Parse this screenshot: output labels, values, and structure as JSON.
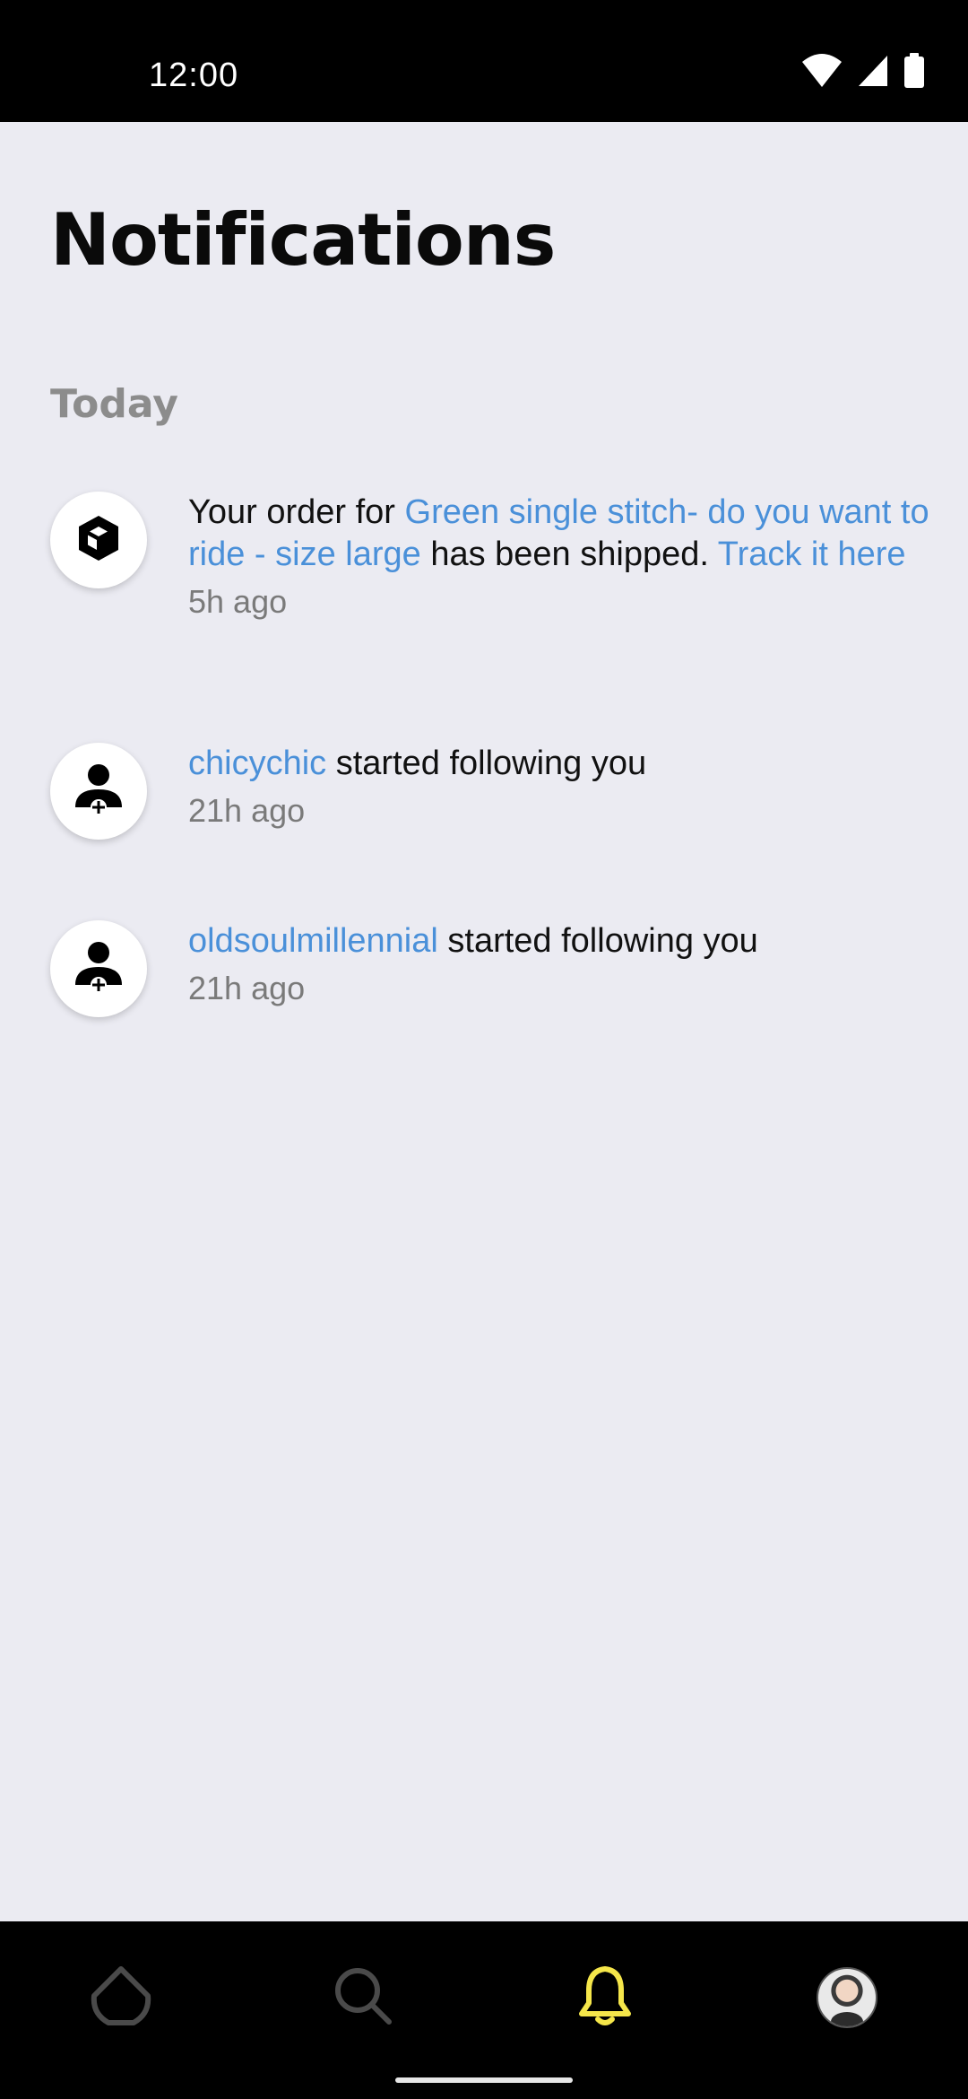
{
  "status_bar": {
    "time": "12:00",
    "icons": [
      "wifi-icon",
      "cellular-signal-icon",
      "battery-icon"
    ]
  },
  "page": {
    "title": "Notifications"
  },
  "sections": [
    {
      "heading": "Today",
      "notifications": [
        {
          "icon": "package-box-icon",
          "text_before": "Your order for ",
          "link_item": "Green single stitch- do you want to ride - size large",
          "text_after": " has been shipped. ",
          "link_track": "Track it here",
          "time": "5h ago"
        },
        {
          "icon": "person-add-icon",
          "link_user": "chicychic",
          "text_after": " started following you",
          "time": "21h ago"
        },
        {
          "icon": "person-add-icon",
          "link_user": "oldsoulmillennial",
          "text_after": " started following you",
          "time": "21h ago"
        }
      ]
    }
  ],
  "bottom_nav": {
    "items": [
      {
        "icon": "home-icon",
        "active": false
      },
      {
        "icon": "search-icon",
        "active": false
      },
      {
        "icon": "bell-icon",
        "active": true
      },
      {
        "icon": "profile-avatar",
        "active": false
      }
    ],
    "colors": {
      "active": "#f5e64a",
      "inactive": "#4a4a4a"
    }
  },
  "colors": {
    "background": "#ebebf2",
    "link": "#4a90d9",
    "muted": "#7a7a7a",
    "heading_muted": "#8c8c8c",
    "bars": "#000000"
  }
}
